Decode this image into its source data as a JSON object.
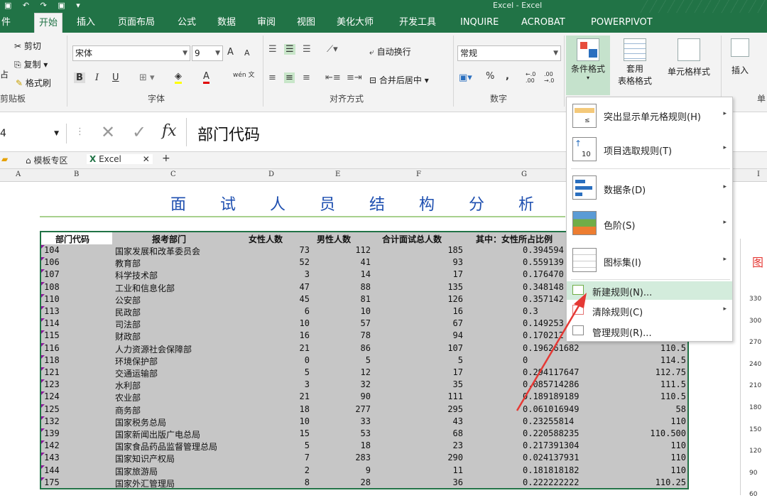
{
  "titlebar": {
    "quick_access": "▣ ↶ ↷ ▣ ▾",
    "title": "Excel - Excel"
  },
  "tabs": [
    "件",
    "开始",
    "插入",
    "页面布局",
    "公式",
    "数据",
    "审阅",
    "视图",
    "美化大师",
    "开发工具",
    "INQUIRE",
    "ACROBAT",
    "POWERPIVOT"
  ],
  "active_tab": "开始",
  "ribbon": {
    "clipboard": {
      "cut": "剪切",
      "copy": "复制",
      "paste_partial": "占",
      "format_painter": "格式刷",
      "group": "剪贴板"
    },
    "font": {
      "name": "宋体",
      "size": "9",
      "group": "字体",
      "bold": "B",
      "italic": "I",
      "underline": "U",
      "grow": "A",
      "shrink": "A",
      "color_a": "A",
      "wen": "wén 文"
    },
    "alignment": {
      "wrap": "自动换行",
      "merge": "合并后居中",
      "group": "对齐方式"
    },
    "number": {
      "format": "常规",
      "percent": "%",
      "comma": ",",
      "inc": "←.0 .00",
      "dec": ".00 →.0",
      "group": "数字"
    },
    "styles": {
      "conditional": "条件格式",
      "table_format_1": "套用",
      "table_format_2": "表格格式",
      "cell_styles": "单元格样式"
    },
    "cells": {
      "insert": "插入",
      "group_partial": "单"
    }
  },
  "formula_bar": {
    "name_box": "4",
    "fx": "fx",
    "content": "部门代码"
  },
  "doc_tabs": {
    "template": "模板专区",
    "file": "Excel",
    "add": "+"
  },
  "columns": [
    "A",
    "B",
    "C",
    "D",
    "E",
    "F",
    "G",
    "I"
  ],
  "sheet_title": [
    "面",
    "试",
    "人",
    "员",
    "结",
    "构",
    "分",
    "析"
  ],
  "table": {
    "headers": [
      "部门代码",
      "报考部门",
      "女性人数",
      "男性人数",
      "合计面试总人数",
      "其中：女性所占比例"
    ],
    "rows": [
      [
        "104",
        "国家发展和改革委员会",
        "73",
        "112",
        "185",
        "0.394594",
        "",
        ""
      ],
      [
        "106",
        "教育部",
        "52",
        "41",
        "93",
        "0.559139",
        "",
        ""
      ],
      [
        "107",
        "科学技术部",
        "3",
        "14",
        "17",
        "0.176470",
        "",
        ""
      ],
      [
        "108",
        "工业和信息化部",
        "47",
        "88",
        "135",
        "0.348148",
        "",
        ""
      ],
      [
        "110",
        "公安部",
        "45",
        "81",
        "126",
        "0.357142",
        "",
        ""
      ],
      [
        "113",
        "民政部",
        "6",
        "10",
        "16",
        "0.3",
        "",
        ""
      ],
      [
        "114",
        "司法部",
        "10",
        "57",
        "67",
        "0.149253",
        "",
        ""
      ],
      [
        "115",
        "财政部",
        "16",
        "78",
        "94",
        "0.170212",
        "",
        ""
      ],
      [
        "116",
        "人力资源社会保障部",
        "21",
        "86",
        "107",
        "0.196261682",
        "110.5"
      ],
      [
        "118",
        "环境保护部",
        "0",
        "5",
        "5",
        "0",
        "114.5"
      ],
      [
        "121",
        "交通运输部",
        "5",
        "12",
        "17",
        "0.294117647",
        "112.75"
      ],
      [
        "123",
        "水利部",
        "3",
        "32",
        "35",
        "0.085714286",
        "111.5"
      ],
      [
        "124",
        "农业部",
        "21",
        "90",
        "111",
        "0.189189189",
        "110.5"
      ],
      [
        "125",
        "商务部",
        "18",
        "277",
        "295",
        "0.061016949",
        "58"
      ],
      [
        "132",
        "国家税务总局",
        "10",
        "33",
        "43",
        "0.23255814",
        "110"
      ],
      [
        "139",
        "国家新闻出版广电总局",
        "15",
        "53",
        "68",
        "0.220588235",
        "110.500"
      ],
      [
        "142",
        "国家食品药品监督管理总局",
        "5",
        "18",
        "23",
        "0.217391304",
        "110"
      ],
      [
        "143",
        "国家知识产权局",
        "7",
        "283",
        "290",
        "0.024137931",
        "110"
      ],
      [
        "144",
        "国家旅游局",
        "2",
        "9",
        "11",
        "0.181818182",
        "110"
      ],
      [
        "175",
        "国家外汇管理局",
        "8",
        "28",
        "36",
        "0.222222222",
        "110.25"
      ]
    ]
  },
  "menu": {
    "items": [
      {
        "label": "突出显示单元格规则(H)",
        "arrow": "▸"
      },
      {
        "label": "项目选取规则(T)",
        "arrow": "▸"
      },
      {
        "label": "数据条(D)",
        "arrow": "▸"
      },
      {
        "label": "色阶(S)",
        "arrow": "▸"
      },
      {
        "label": "图标集(I)",
        "arrow": "▸"
      },
      {
        "label": "新建规则(N)..."
      },
      {
        "label": "清除规则(C)",
        "arrow": "▸"
      },
      {
        "label": "管理规则(R)..."
      }
    ]
  },
  "right_chart": {
    "title_partial": "图",
    "yticks": [
      "330",
      "300",
      "270",
      "240",
      "210",
      "180",
      "150",
      "120",
      "90",
      "60"
    ]
  },
  "colors": {
    "excel_green": "#217346",
    "title_blue": "#1e4fb0",
    "highlight": "#d3ecdc",
    "arrow_red": "#e53935"
  }
}
